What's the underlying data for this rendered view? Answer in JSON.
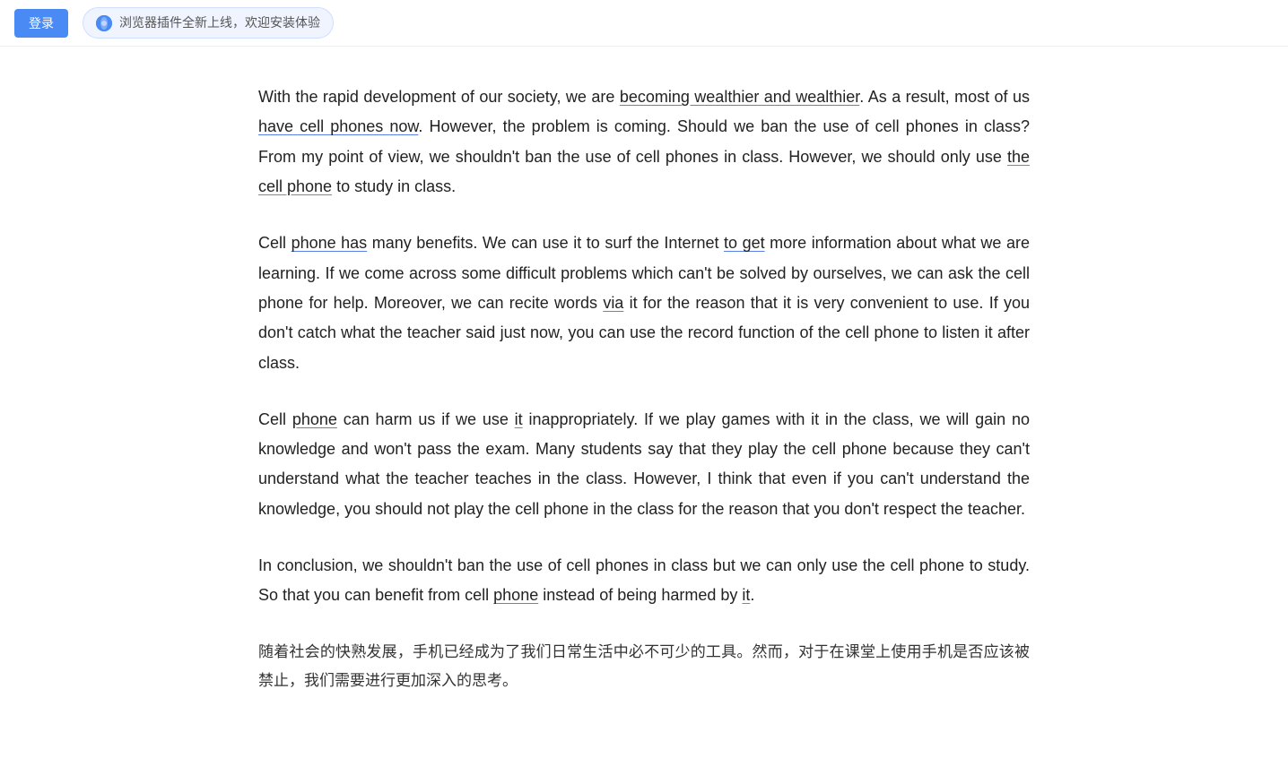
{
  "topbar": {
    "login_label": "登录",
    "plugin_text": "浏览器插件全新上线，欢迎安装体验"
  },
  "content": {
    "paragraphs": [
      {
        "id": "para1",
        "html": "With the rapid development of our society, we are <span class='underline-blue'>becoming wealthier and wealthier</span>. As a result, most of us <span class='underline-blue'>have cell phones now</span>. However, the problem is coming. Should we ban the use of cell phones in class? From my point of view, we shouldn't ban the use of cell phones in class. However, we should only use <span class='underline-thin'>the cell phone</span> to study in class."
      },
      {
        "id": "para2",
        "html": "Cell <span class='underline-blue'>phone has</span> many benefits. We can use it to surf the Internet <span class='underline-blue'>to get</span> more information about what we are learning. If we come across some difficult problems which can't be solved by ourselves, we can ask the cell phone for help. Moreover, we can recite words <span class='underline-blue'>via</span> it for the reason that it is very convenient to use. If you don't catch what the teacher said just now, you can use the record function of the cell phone to listen it after class."
      },
      {
        "id": "para3",
        "html": "Cell <span class='underline-blue'>phone</span> can harm us if we use <span class='underline-thin'>it</span> inappropriately. If we play games with it in the class, we will gain no knowledge and won't pass the exam. Many students say that they play the cell phone because they can't understand what the teacher teaches in the class. However, I think that even if you can't understand the knowledge, you should not play the cell phone in the class for the reason that you don't respect the teacher."
      },
      {
        "id": "para4",
        "html": "In conclusion, we shouldn't ban the use of cell phones in class but we can only use the cell phone to study. So that you can benefit from cell <span class='underline-blue'>phone</span> instead of being harmed by <span class='underline-thin'>it</span>."
      },
      {
        "id": "para5",
        "html": "随着社会的快熟发展，手机已经成为了我们日常生活中必不可少的工具。然而，对于在课堂上使用手机是否应该被禁止，我们需要进行更加深入的思考。"
      }
    ]
  }
}
